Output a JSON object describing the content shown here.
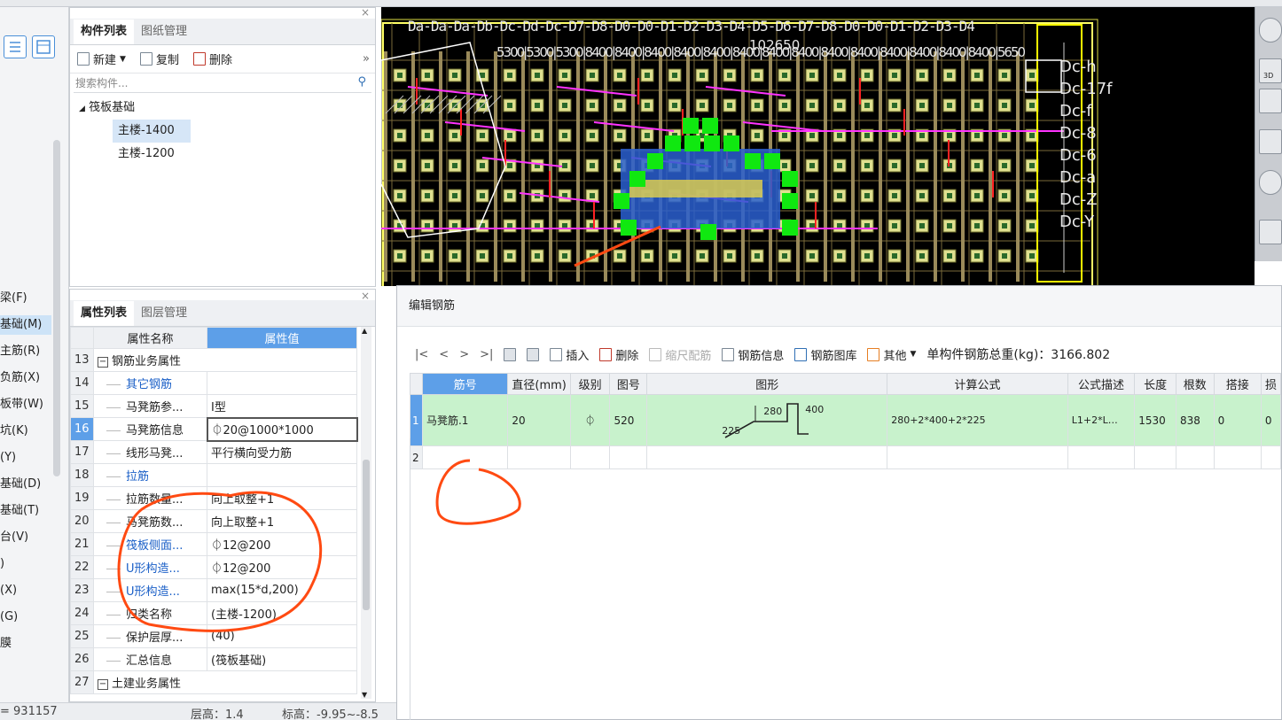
{
  "left_sidebar": {
    "categories": [
      {
        "label": "梁(F)",
        "selected": false
      },
      {
        "label": "基础(M)",
        "selected": true
      },
      {
        "label": "主筋(R)",
        "selected": false
      },
      {
        "label": "负筋(X)",
        "selected": false
      },
      {
        "label": "板带(W)",
        "selected": false
      },
      {
        "label": "坑(K)",
        "selected": false
      },
      {
        "label": "(Y)",
        "selected": false
      },
      {
        "label": "基础(D)",
        "selected": false
      },
      {
        "label": "基础(T)",
        "selected": false
      },
      {
        "label": "台(V)",
        "selected": false
      },
      {
        "label": ")",
        "selected": false
      },
      {
        "label": "(X)",
        "selected": false
      },
      {
        "label": "(G)",
        "selected": false
      },
      {
        "label": "膜",
        "selected": false
      }
    ]
  },
  "component_panel": {
    "tabs": [
      "构件列表",
      "图纸管理"
    ],
    "toolbar": {
      "new": "新建",
      "copy": "复制",
      "delete": "删除"
    },
    "search_placeholder": "搜索构件...",
    "tree": {
      "root": "筏板基础",
      "children": [
        {
          "label": "主楼-1400",
          "selected": true
        },
        {
          "label": "主楼-1200",
          "selected": false
        }
      ]
    }
  },
  "property_panel": {
    "tabs": [
      "属性列表",
      "图层管理"
    ],
    "headers": {
      "name": "属性名称",
      "value": "属性值"
    },
    "rows": [
      {
        "num": "13",
        "name": "钢筋业务属性",
        "value": "",
        "group": true,
        "blue": false
      },
      {
        "num": "14",
        "name": "其它钢筋",
        "value": "",
        "group": false,
        "blue": true
      },
      {
        "num": "15",
        "name": "马凳筋参...",
        "value": "Ⅰ型",
        "group": false,
        "blue": false
      },
      {
        "num": "16",
        "name": "马凳筋信息",
        "value": "⏀20@1000*1000",
        "group": false,
        "blue": false,
        "selected": true
      },
      {
        "num": "17",
        "name": "线形马凳...",
        "value": "平行横向受力筋",
        "group": false,
        "blue": false
      },
      {
        "num": "18",
        "name": "拉筋",
        "value": "",
        "group": false,
        "blue": true
      },
      {
        "num": "19",
        "name": "拉筋数量...",
        "value": "向上取整+1",
        "group": false,
        "blue": false
      },
      {
        "num": "20",
        "name": "马凳筋数...",
        "value": "向上取整+1",
        "group": false,
        "blue": false
      },
      {
        "num": "21",
        "name": "筏板侧面...",
        "value": "⏀12@200",
        "group": false,
        "blue": true
      },
      {
        "num": "22",
        "name": "U形构造...",
        "value": "⏀12@200",
        "group": false,
        "blue": true
      },
      {
        "num": "23",
        "name": "U形构造...",
        "value": "max(15*d,200)",
        "group": false,
        "blue": true
      },
      {
        "num": "24",
        "name": "归类名称",
        "value": "(主楼-1200)",
        "group": false,
        "blue": false
      },
      {
        "num": "25",
        "name": "保护层厚...",
        "value": "(40)",
        "group": false,
        "blue": false
      },
      {
        "num": "26",
        "name": "汇总信息",
        "value": "(筏板基础)",
        "group": false,
        "blue": false
      },
      {
        "num": "27",
        "name": "土建业务属性",
        "value": "",
        "group": true,
        "blue": false
      }
    ]
  },
  "cad": {
    "axis_top_labels": "Da-Da-Da-Db-Dc-Dd-Dc-D7-D8-D0-D0-D1-D2-D3-D4-D5-D6-D7-D8-D0-D0-D1-D2-D3-D4",
    "dimension_total": "102650",
    "dimension_row": "5300|5300|5300|8400|8400|8400|8400|8400|8400|8400|8400|8400|8400|8400|8400|8400|8400|5650",
    "right_labels": [
      "Dc-h",
      "Dc-17f",
      "Dc-f",
      "Dc-8",
      "Dc-6",
      "Dc-a",
      "Dc-Z",
      "Dc-Y"
    ]
  },
  "rebar_dialog": {
    "title": "编辑钢筋",
    "toolbar": {
      "first": "|<",
      "prev": "<",
      "next": ">",
      "last": ">|",
      "insert": "插入",
      "delete": "删除",
      "scale": "缩尺配筋",
      "info": "钢筋信息",
      "library": "钢筋图库",
      "other": "其他",
      "total": "单构件钢筋总重(kg)：3166.802"
    },
    "columns": [
      "筋号",
      "直径(mm)",
      "级别",
      "图号",
      "图形",
      "计算公式",
      "公式描述",
      "长度",
      "根数",
      "搭接",
      "损"
    ],
    "rows": [
      {
        "idx": "1",
        "name": "马凳筋.1",
        "diameter": "20",
        "grade": "⏀",
        "fig": "520",
        "shape_a": "225",
        "shape_b": "280",
        "shape_c": "400",
        "formula": "280+2*400+2*225",
        "desc": "L1+2*L…",
        "length": "1530",
        "count": "838",
        "lap": "0",
        "loss": "0"
      },
      {
        "idx": "2",
        "name": "",
        "diameter": "",
        "grade": "",
        "fig": "",
        "formula": "",
        "desc": "",
        "length": "",
        "count": "",
        "lap": "",
        "loss": ""
      }
    ]
  },
  "status": {
    "left": "= 931157",
    "floor_height": "层高：1.4",
    "elevation": "标高：-9.95~-8.5"
  },
  "colors": {
    "accent": "#5d9fe8",
    "selected_row": "#c8f2cc",
    "annotation": "#ff4a12"
  }
}
